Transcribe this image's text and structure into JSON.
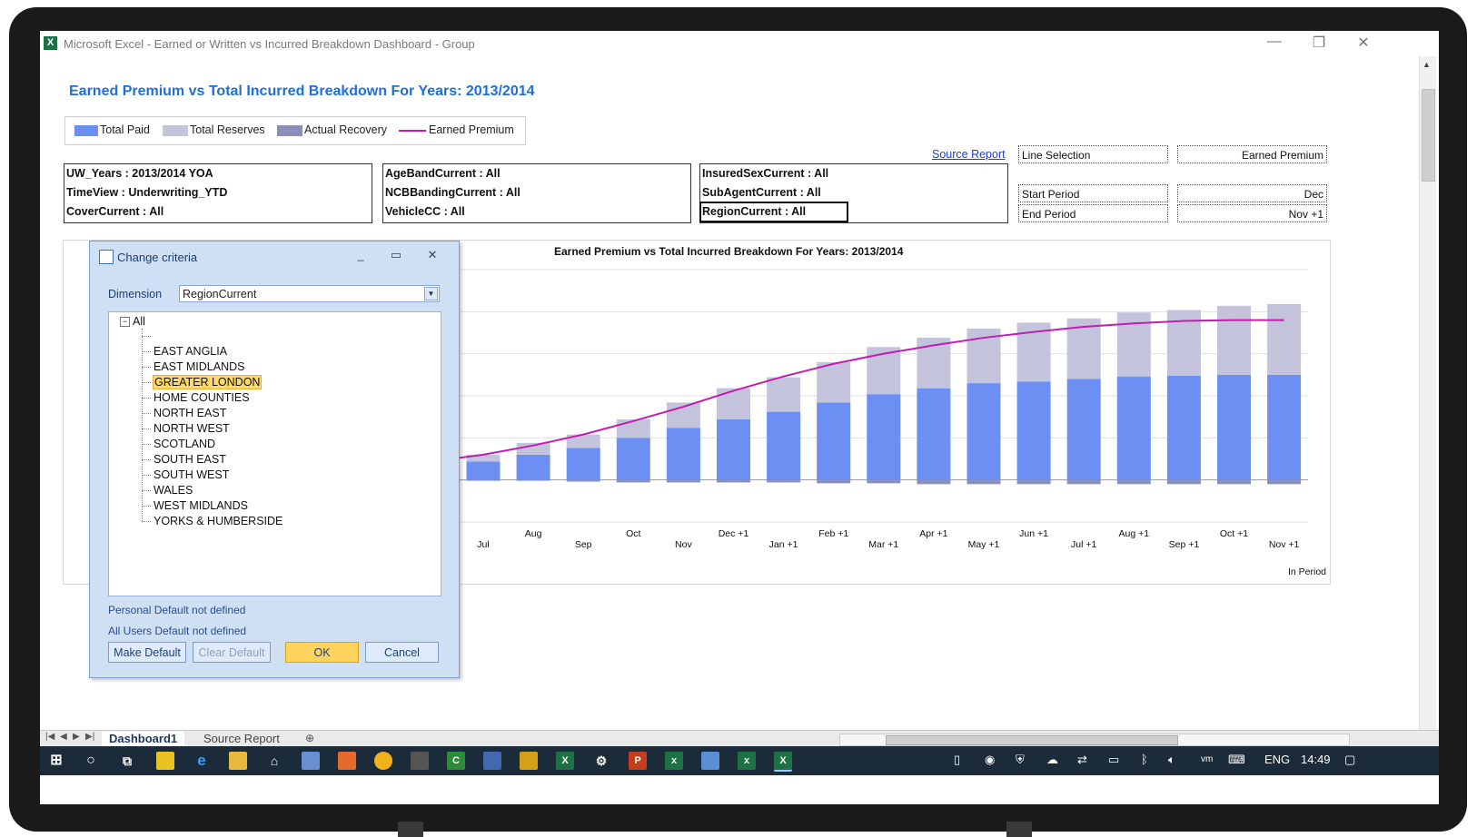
{
  "window": {
    "title": "Microsoft Excel - Earned or Written vs Incurred Breakdown Dashboard - Group",
    "app_icon": "excel-icon",
    "controls": [
      "minimize-icon",
      "restore-icon",
      "close-icon"
    ]
  },
  "dashboard": {
    "title": "Earned Premium vs Total Incurred Breakdown For Years: 2013/2014",
    "legend": [
      "Total Paid",
      "Total Reserves",
      "Actual Recovery",
      "Earned Premium"
    ],
    "criteria": [
      [
        "UW_Years : 2013/2014 YOA",
        "TimeView : Underwriting_YTD",
        "CoverCurrent : All"
      ],
      [
        "AgeBandCurrent : All",
        "NCBBandingCurrent : All",
        "VehicleCC : All"
      ],
      [
        "InsuredSexCurrent : All",
        "SubAgentCurrent : All",
        "RegionCurrent : All"
      ]
    ],
    "source_report_link": "Source Report",
    "settings": {
      "line_selection_label": "Line Selection",
      "line_selection_value": "Earned Premium",
      "start_period_label": "Start Period",
      "start_period_value": "Dec",
      "end_period_label": "End Period",
      "end_period_value": "Nov +1"
    }
  },
  "chart_data": {
    "type": "bar",
    "title": "Earned Premium vs Total Incurred Breakdown For Years: 2013/2014",
    "xlabel": "In Period",
    "categories": [
      "Jul",
      "Aug",
      "Sep",
      "Oct",
      "Nov",
      "Dec +1",
      "Jan +1",
      "Feb +1",
      "Mar +1",
      "Apr +1",
      "May +1",
      "Jun +1",
      "Jul +1",
      "Aug +1",
      "Sep +1",
      "Oct +1",
      "Nov +1"
    ],
    "series": [
      {
        "name": "Total Paid",
        "values": [
          22,
          30,
          38,
          50,
          62,
          72,
          81,
          92,
          102,
          109,
          115,
          117,
          120,
          123,
          124,
          125,
          125
        ],
        "color": "#6b8ff2"
      },
      {
        "name": "Total Reserves",
        "values": [
          8,
          14,
          16,
          22,
          30,
          37,
          41,
          48,
          56,
          60,
          65,
          70,
          72,
          76,
          78,
          82,
          84
        ],
        "color": "#c3c3dc"
      },
      {
        "name": "Actual Recovery",
        "values": [
          -1,
          -1,
          -2,
          -3,
          -3,
          -3,
          -3,
          -4,
          -4,
          -5,
          -5,
          -5,
          -5,
          -5,
          -5,
          -5,
          -5
        ],
        "color": "#8c8fb8"
      },
      {
        "name": "Earned Premium",
        "type": "line",
        "values": [
          30,
          41,
          54,
          70,
          87,
          106,
          123,
          138,
          150,
          160,
          169,
          176,
          182,
          186,
          189,
          190,
          190
        ],
        "color": "#c21cb0"
      }
    ],
    "ylim": [
      -50,
      250
    ],
    "grid": true,
    "legend": "top"
  },
  "dialog": {
    "title": "Change criteria",
    "dimension_label": "Dimension",
    "dimension_value": "RegionCurrent",
    "tree_root": "All",
    "tree_items": [
      "EAST ANGLIA",
      "EAST MIDLANDS",
      "GREATER LONDON",
      "HOME COUNTIES",
      "NORTH EAST",
      "NORTH WEST",
      "SCOTLAND",
      "SOUTH EAST",
      "SOUTH WEST",
      "WALES",
      "WEST MIDLANDS",
      "YORKS & HUMBERSIDE"
    ],
    "selected_item": "GREATER LONDON",
    "personal_default": "Personal Default not defined",
    "all_users_default": "All Users Default not defined",
    "buttons": {
      "make_default": "Make Default",
      "clear_default": "Clear Default",
      "ok": "OK",
      "cancel": "Cancel"
    }
  },
  "sheet_tabs": [
    "Dashboard1",
    "Source Report"
  ],
  "taskbar": {
    "language": "ENG",
    "time": "14:49"
  }
}
